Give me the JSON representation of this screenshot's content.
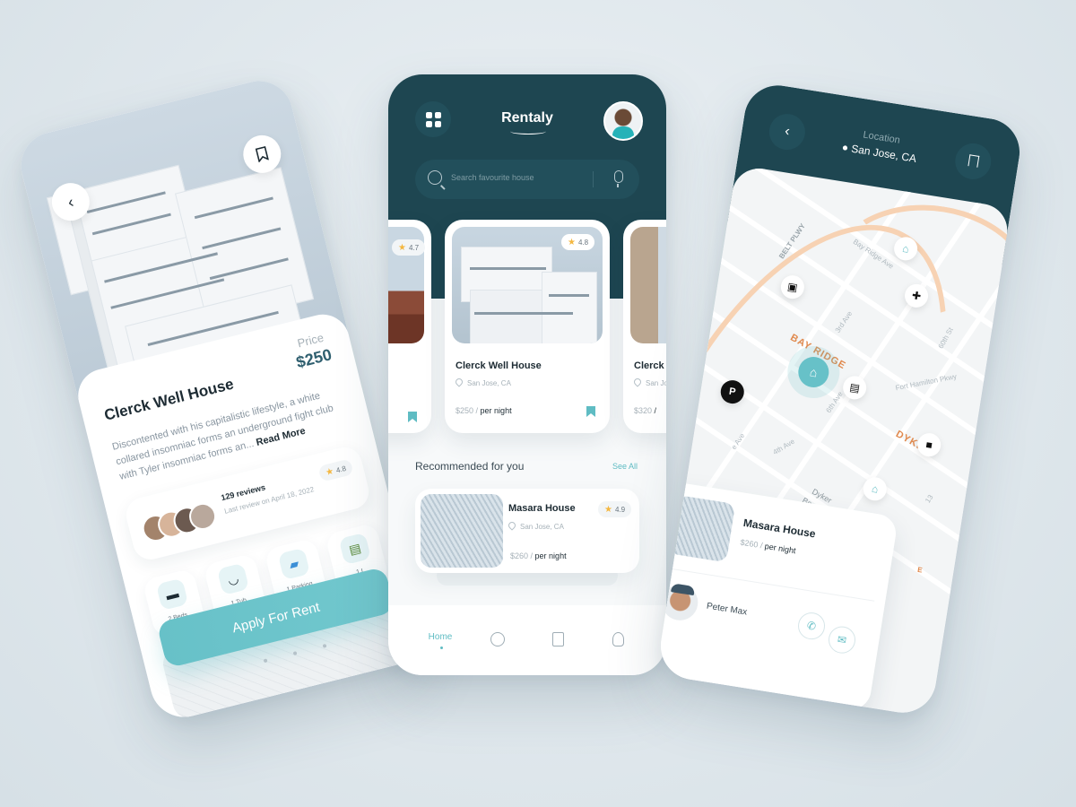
{
  "left_screen": {
    "title": "Clerck Well House",
    "price_label": "Price",
    "price": "$250",
    "description": "Discontented with his capitalistic lifestyle, a white collared insomniac forms an underground fight club with Tyler insomniac forms an...",
    "read_more": "Read More",
    "reviews_count": "129 reviews",
    "last_review": "Last review on April 18, 2022",
    "rating": "4.8",
    "amenities": [
      {
        "label": "2 Beds",
        "icon": "bed-icon"
      },
      {
        "label": "1 Tub",
        "icon": "tub-icon"
      },
      {
        "label": "1 Parking",
        "icon": "car-icon"
      },
      {
        "label": "1 L",
        "icon": "laundry-icon"
      }
    ],
    "apply_button": "Apply For Rent",
    "back_icon": "chevron-left-icon",
    "save_icon": "bookmark-icon"
  },
  "center_screen": {
    "app_name": "Rentaly",
    "search_placeholder": "Search favourite house",
    "cards": [
      {
        "title": "",
        "location": "",
        "price": "",
        "per": "",
        "rating": "4.7"
      },
      {
        "title": "Clerck Well House",
        "location": "San Jose, CA",
        "price": "$250",
        "per": "per night",
        "rating": "4.8"
      },
      {
        "title": "Clerck W",
        "location": "San Jo",
        "price": "$320",
        "per": "/",
        "rating": ""
      }
    ],
    "recommended_title": "Recommended for you",
    "see_all": "See All",
    "recommended": {
      "name": "Masara House",
      "location": "San Jose, CA",
      "price": "$260",
      "per": "per night",
      "rating": "4.9"
    },
    "nav": {
      "home": "Home",
      "icons": [
        "chat-icon",
        "bookmark-icon",
        "profile-icon"
      ]
    }
  },
  "right_screen": {
    "location_label": "Location",
    "location_value": "San Jose, CA",
    "map_labels": {
      "belt": "BELT PLWY",
      "bay_ridge": "BAY RIDGE",
      "dyke": "DYKE",
      "dyker": "Dyker",
      "beach_golf": "Beach Golf",
      "bay_ridge_ave": "Bay Ridge Ave",
      "third_ave": "3rd Ave",
      "sixth_ave": "6th Ave",
      "fourth_ave": "4th Ave",
      "fort_hamilton": "Fort Hamilton Pkwy",
      "sixtieth": "60th St",
      "thirteenth": "13",
      "parking": "P",
      "ave_label": "e Ave",
      "e_label": "E"
    },
    "property": {
      "name": "Masara House",
      "price": "$260",
      "per": "per night"
    },
    "agent_name": "Peter Max",
    "colors": {
      "primary": "#1e4651",
      "accent": "#67c1c8",
      "road": "#f7d2b3",
      "label_orange": "#e0894d"
    }
  }
}
